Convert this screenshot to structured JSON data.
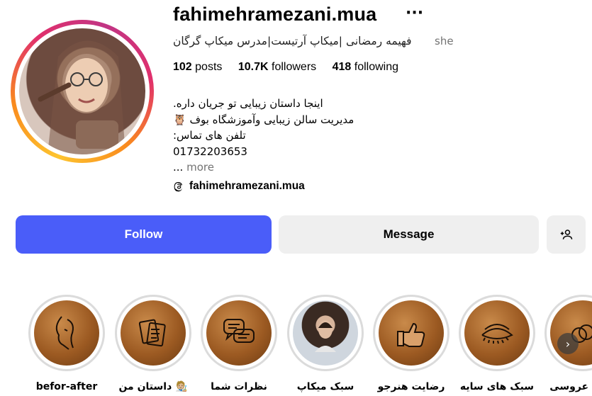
{
  "profile": {
    "username": "fahimehramezani.mua",
    "more_icon": "ellipsis-icon",
    "pronoun": "she",
    "full_name": "فهیمه رمضانی |میکاپ آرتیست|مدرس میکاپ گرگان",
    "avatar_icon": "profile-photo"
  },
  "stats": {
    "posts_count": "102",
    "posts_label": "posts",
    "followers_count": "10.7K",
    "followers_label": "followers",
    "following_count": "418",
    "following_label": "following"
  },
  "bio": {
    "line1": "اینجا داستان زیبایی تو جریان داره.",
    "line2": "مدیریت سالن زیبایی وآموزشگاه بوف 🦉",
    "line3": "تلفن های تماس:",
    "line4": "01732203653",
    "more_prefix": "...",
    "more_label": "more"
  },
  "threads": {
    "icon": "threads-icon",
    "handle": "fahimehramezani.mua"
  },
  "actions": {
    "follow_label": "Follow",
    "message_label": "Message",
    "add_user_icon": "add-user-icon"
  },
  "colors": {
    "follow_button": "#4a5df9",
    "secondary_button": "#efefef",
    "muted_text": "#737373"
  },
  "highlights": [
    {
      "label": "befor-after",
      "icon": "face-line-icon"
    },
    {
      "label": "داستان من 🧑🏼‍🎨",
      "icon": "notes-icon"
    },
    {
      "label": "نظرات شما",
      "icon": "chat-bubble-icon"
    },
    {
      "label": "سبک میکاپ",
      "icon": "photo-cover"
    },
    {
      "label": "رضایت هنرجو",
      "icon": "thumbs-up-icon"
    },
    {
      "label": "سبک های سایه",
      "icon": "eye-makeup-icon"
    },
    {
      "label": "سبک عروسی",
      "icon": "ring-icon"
    }
  ],
  "scroll_icon": "chevron-right-icon"
}
